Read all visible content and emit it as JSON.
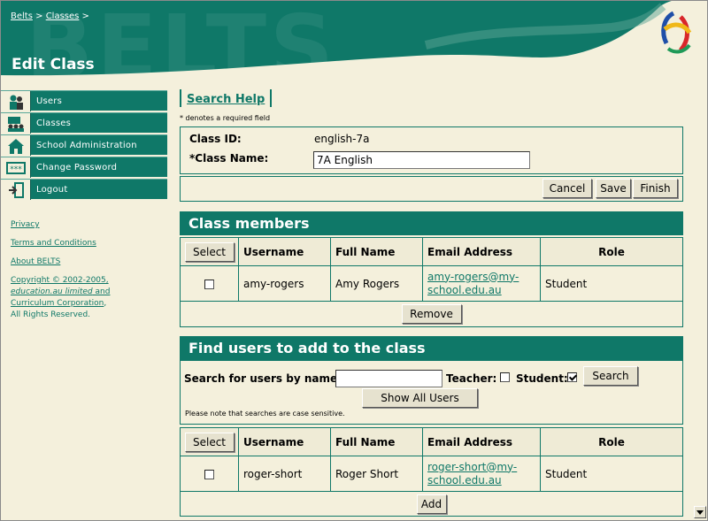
{
  "header": {
    "watermark": "BELTS",
    "breadcrumb": [
      {
        "label": "Belts"
      },
      {
        "label": "Classes"
      }
    ],
    "separator": ">",
    "title": "Edit Class"
  },
  "sidebar": {
    "items": [
      {
        "label": "Users",
        "icon": "users-icon"
      },
      {
        "label": "Classes",
        "icon": "classes-icon"
      },
      {
        "label": "School Administration",
        "icon": "school-icon"
      },
      {
        "label": "Change Password",
        "icon": "password-icon"
      },
      {
        "label": "Logout",
        "icon": "logout-icon"
      }
    ],
    "links": {
      "privacy": "Privacy",
      "terms": "Terms and Conditions",
      "about": "About BELTS"
    },
    "copyright": {
      "line1": "Copyright © 2002-2005,",
      "org1": "education.au limited",
      "and": " and",
      "org2": "Curriculum Corporation",
      "line4": "All Rights Reserved."
    }
  },
  "help": {
    "label": "Search Help"
  },
  "required_note": "* denotes a required field",
  "class_form": {
    "id_label": "Class ID:",
    "id_value": "english-7a",
    "name_label": "*Class Name:",
    "name_value": "7A English"
  },
  "actions": {
    "cancel": "Cancel",
    "save": "Save",
    "finish": "Finish"
  },
  "members": {
    "title": "Class members",
    "select_label": "Select",
    "columns": [
      "Username",
      "Full Name",
      "Email Address",
      "Role"
    ],
    "rows": [
      {
        "username": "amy-rogers",
        "full_name": "Amy Rogers",
        "email_line1": "amy-rogers@my-",
        "email_line2": "school.edu.au",
        "role": "Student"
      }
    ],
    "remove_label": "Remove"
  },
  "find": {
    "title": "Find users to add to the class",
    "search_label": "Search for users by name:",
    "search_value": "",
    "teacher_label": "Teacher:",
    "teacher_checked": false,
    "student_label": "Student:",
    "student_checked": true,
    "search_button": "Search",
    "show_all": "Show All Users",
    "note": "Please note that searches are case sensitive.",
    "select_label": "Select",
    "columns": [
      "Username",
      "Full Name",
      "Email Address",
      "Role"
    ],
    "rows": [
      {
        "username": "roger-short",
        "full_name": "Roger Short",
        "email_line1": "roger-short@my-",
        "email_line2": "school.edu.au",
        "role": "Student"
      }
    ],
    "add_label": "Add"
  },
  "colors": {
    "brand": "#0f7868",
    "background": "#f4f0dc"
  }
}
